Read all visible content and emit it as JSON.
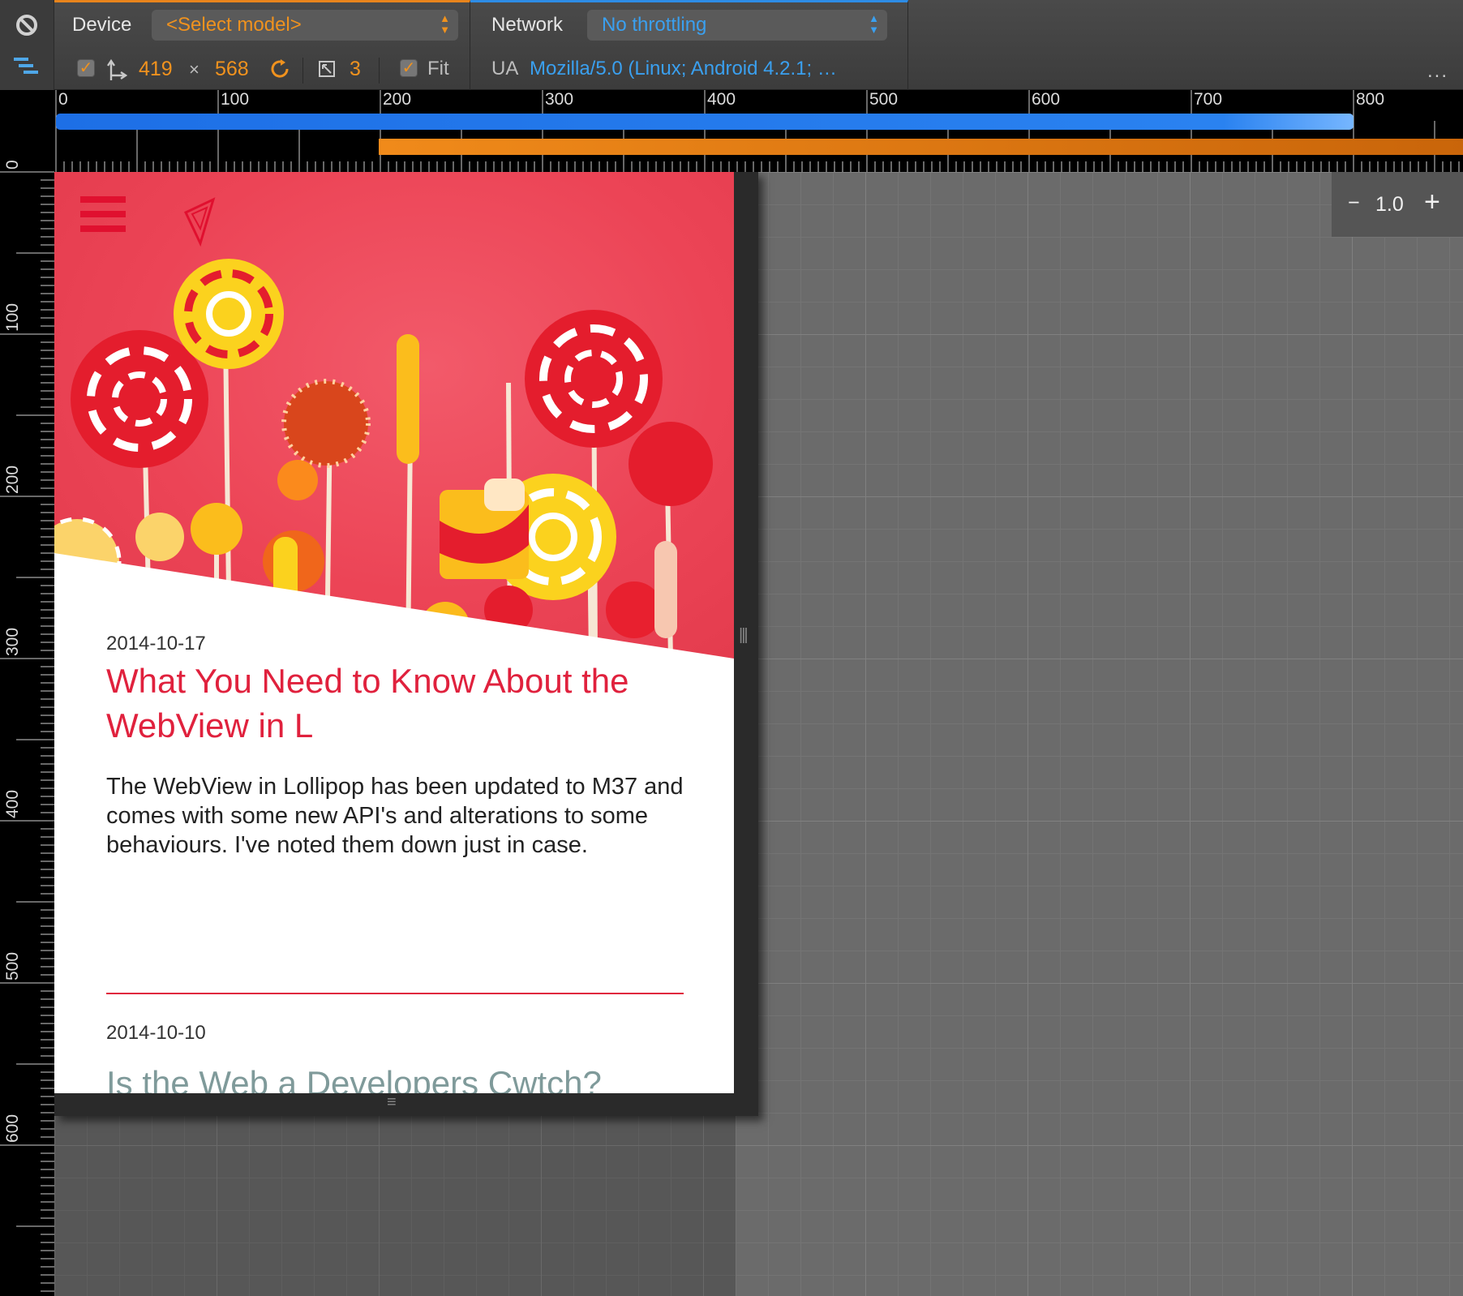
{
  "toolbar": {
    "device_label": "Device",
    "device_model": "<Select model>",
    "width": "419",
    "times": "×",
    "height": "568",
    "pixel_ratio": "3",
    "fit_label": "Fit",
    "network_label": "Network",
    "network_value": "No throttling",
    "ua_label": "UA",
    "ua_value": "Mozilla/5.0 (Linux; Android 4.2.1; …",
    "more": "..."
  },
  "rulers": {
    "horizontal": [
      "0",
      "100",
      "200",
      "300",
      "400",
      "500",
      "600",
      "700",
      "800"
    ],
    "vertical": [
      "0",
      "100",
      "200",
      "300",
      "400",
      "500",
      "600"
    ]
  },
  "posts": [
    {
      "date": "2014-10-17",
      "title": "What You Need to Know About the WebView in L",
      "excerpt": "The WebView in Lollipop has been updated to M37 and comes with some new API's and alterations to some behaviours. I've noted them down just in case."
    },
    {
      "date": "2014-10-10",
      "title": "Is the Web a Developers Cwtch?"
    }
  ],
  "zoom": {
    "minus": "−",
    "value": "1.0",
    "plus": "+"
  },
  "colors": {
    "device_accent": "#f0921e",
    "network_accent": "#3aa0f0",
    "post_title": "#e0213d",
    "hero_bg": "#ec4456"
  },
  "icons": [
    "block-icon",
    "media-queries-icon",
    "swap-dimensions-icon",
    "rotate-icon",
    "device-pixel-ratio-icon",
    "hamburger-menu-icon",
    "brand-logo-icon"
  ]
}
